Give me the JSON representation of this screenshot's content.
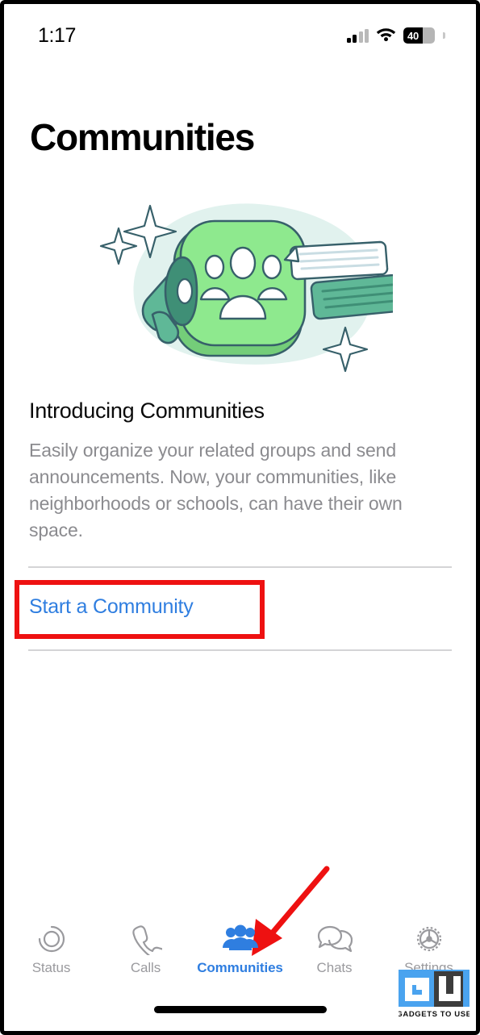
{
  "status_bar": {
    "time": "1:17",
    "signal_icon": "cellular-signal-icon",
    "wifi_icon": "wifi-icon",
    "battery_icon": "battery-icon",
    "battery_level": "40",
    "battery_percent": 40
  },
  "header": {
    "title": "Communities"
  },
  "illustration": {
    "name": "communities-illustration",
    "blob_color": "#e1f2ee",
    "card_color": "#8ee98e",
    "card_shadow_color": "#74cd79",
    "outline_color": "#37606a",
    "megaphone_color": "#5fb897",
    "megaphone_dark_color": "#3f8f76",
    "bubble_white_color": "#ffffff",
    "bubble_green_color": "#5fb897",
    "people_color": "#ffffff",
    "star_color": "#ffffff"
  },
  "intro": {
    "heading": "Introducing Communities",
    "body": "Easily organize your related groups and send announcements. Now, your communities, like neighborhoods or schools, can have their own space."
  },
  "actions": {
    "start_community_label": "Start a Community",
    "link_color": "#2f7ee0",
    "divider_color": "#d4d4d6"
  },
  "annotations": {
    "highlight_box": {
      "name": "red-highlight-box",
      "color": "#ee1111",
      "target": "Start a Community"
    },
    "arrow": {
      "name": "red-pointer-arrow",
      "color": "#ee1111",
      "target": "Communities tab"
    }
  },
  "tab_bar": {
    "active_color": "#2f7ee0",
    "inactive_color": "#9a9a9e",
    "tabs": [
      {
        "label": "Status",
        "icon": "status-rings-icon",
        "active": false
      },
      {
        "label": "Calls",
        "icon": "phone-handset-icon",
        "active": false
      },
      {
        "label": "Communities",
        "icon": "people-group-icon",
        "active": true
      },
      {
        "label": "Chats",
        "icon": "chat-bubbles-icon",
        "active": false
      },
      {
        "label": "Settings",
        "icon": "gear-icon",
        "active": false
      }
    ]
  },
  "watermark": {
    "logo_text": "GU",
    "caption": "GADGETS TO USE",
    "blue": "#4aa3ef",
    "dark": "#3c3c3c"
  },
  "home_indicator": "home-indicator"
}
